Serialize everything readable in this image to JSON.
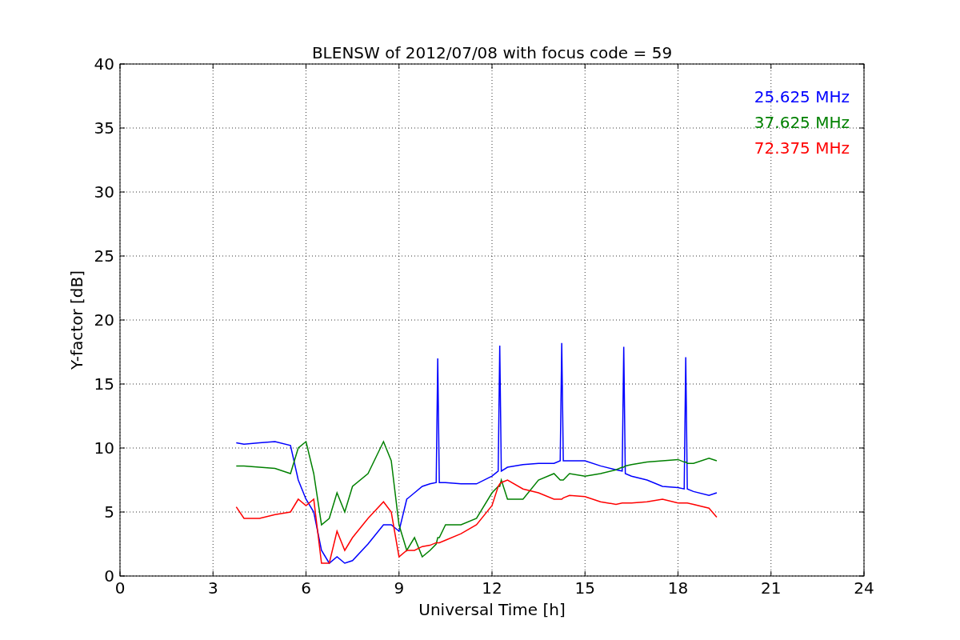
{
  "chart_data": {
    "type": "line",
    "title": "BLENSW of 2012/07/08 with focus code = 59",
    "xlabel": "Universal Time [h]",
    "ylabel": "Y-factor [dB]",
    "x": [
      3.75,
      4,
      4.5,
      5,
      5.5,
      5.75,
      6,
      6.25,
      6.5,
      6.75,
      7,
      7.25,
      7.5,
      8,
      8.5,
      8.75,
      9,
      9.25,
      9.5,
      9.75,
      10,
      10.2,
      10.25,
      10.3,
      10.5,
      11,
      11.5,
      12,
      12.2,
      12.25,
      12.3,
      12.5,
      13,
      13.5,
      14,
      14.2,
      14.25,
      14.3,
      14.5,
      15,
      15.5,
      16,
      16.2,
      16.25,
      16.3,
      16.5,
      17,
      17.5,
      18,
      18.2,
      18.25,
      18.3,
      18.5,
      19,
      19.25
    ],
    "series": [
      {
        "name": "25.625 MHz",
        "color": "#0000ff",
        "values": [
          10.4,
          10.3,
          10.4,
          10.5,
          10.2,
          7.5,
          6,
          5,
          2,
          1,
          1.5,
          1,
          1.2,
          2.5,
          4,
          4,
          3.5,
          6,
          6.5,
          7,
          7.2,
          7.3,
          17,
          7.3,
          7.3,
          7.2,
          7.2,
          7.8,
          8.2,
          18,
          8.2,
          8.5,
          8.7,
          8.8,
          8.8,
          9,
          18.2,
          9,
          9,
          9,
          8.6,
          8.3,
          8.2,
          17.9,
          8,
          7.8,
          7.5,
          7,
          6.9,
          6.8,
          17.1,
          6.8,
          6.6,
          6.3,
          6.5
        ]
      },
      {
        "name": "37.625 MHz",
        "color": "#008000",
        "values": [
          8.6,
          8.6,
          8.5,
          8.4,
          8,
          10,
          10.5,
          8,
          4,
          4.5,
          6.5,
          5,
          7,
          8,
          10.5,
          9,
          4,
          2,
          3,
          1.5,
          2,
          2.5,
          3,
          3,
          4,
          4,
          4.5,
          6.5,
          7,
          7,
          7.5,
          6,
          6,
          7.5,
          8,
          7.5,
          7.5,
          7.5,
          8,
          7.8,
          8,
          8.3,
          8.5,
          8.5,
          8.6,
          8.7,
          8.9,
          9,
          9.1,
          8.9,
          8.9,
          8.8,
          8.8,
          9.2,
          9
        ]
      },
      {
        "name": "72.375 MHz",
        "color": "#ff0000",
        "values": [
          5.4,
          4.5,
          4.5,
          4.8,
          5,
          6,
          5.5,
          6,
          1,
          1,
          3.5,
          2,
          3,
          4.5,
          5.8,
          5,
          1.5,
          2,
          2,
          2.3,
          2.4,
          2.6,
          2.6,
          2.6,
          2.8,
          3.3,
          4,
          5.5,
          7,
          7.2,
          7.3,
          7.5,
          6.8,
          6.5,
          6,
          6,
          6,
          6.1,
          6.3,
          6.2,
          5.8,
          5.6,
          5.7,
          5.7,
          5.7,
          5.7,
          5.8,
          6,
          5.7,
          5.7,
          5.7,
          5.7,
          5.6,
          5.3,
          4.6
        ]
      }
    ],
    "grid": true,
    "xlim": [
      0,
      24
    ],
    "ylim": [
      0,
      40
    ],
    "xticks": [
      0,
      3,
      6,
      9,
      12,
      15,
      18,
      21,
      24
    ],
    "yticks": [
      0,
      5,
      10,
      15,
      20,
      25,
      30,
      35,
      40
    ]
  }
}
